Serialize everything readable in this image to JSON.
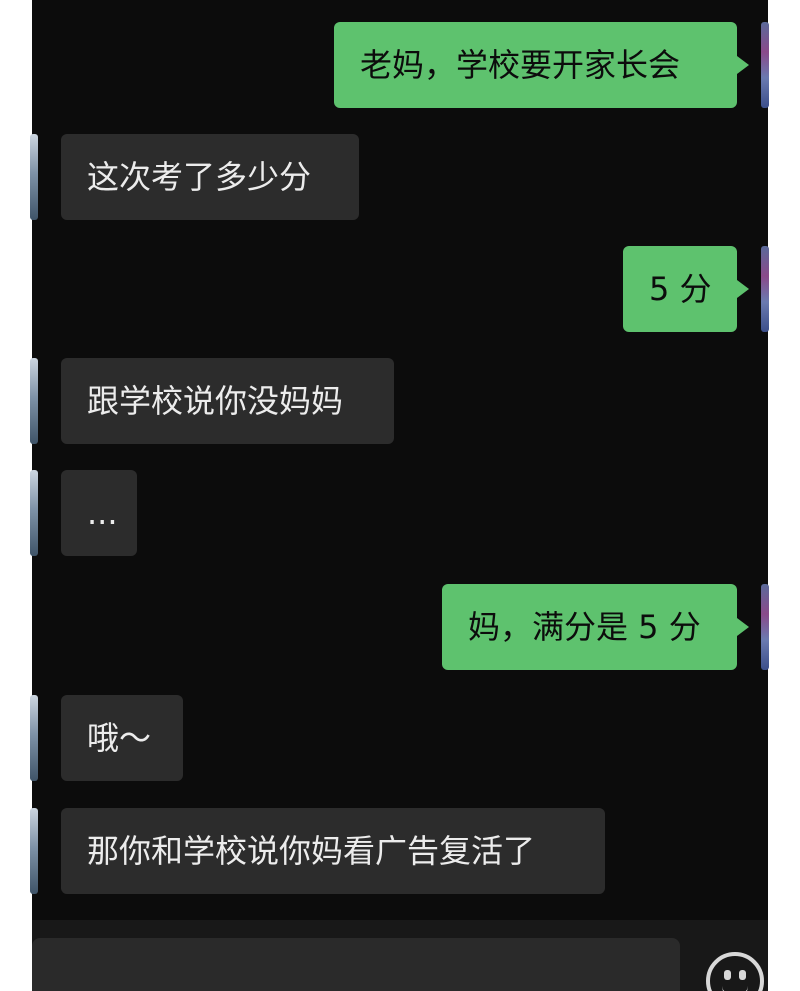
{
  "messages": [
    {
      "side": "out",
      "text": "老妈，学校要开家长会"
    },
    {
      "side": "in",
      "text": "这次考了多少分"
    },
    {
      "side": "out",
      "text": "5 分"
    },
    {
      "side": "in",
      "text": "跟学校说你没妈妈"
    },
    {
      "side": "in",
      "text": "..."
    },
    {
      "side": "out",
      "text": "妈，满分是 5 分"
    },
    {
      "side": "in",
      "text": "哦～"
    },
    {
      "side": "in",
      "text": "那你和学校说你妈看广告复活了"
    }
  ],
  "input": {
    "placeholder": "",
    "emoji_icon": "smiley-face-icon"
  },
  "colors": {
    "background": "#0c0c0c",
    "outgoing_bubble": "#5ec26e",
    "incoming_bubble": "#2c2c2c",
    "text_light": "#ececec",
    "text_dark": "#0c0c0c"
  }
}
